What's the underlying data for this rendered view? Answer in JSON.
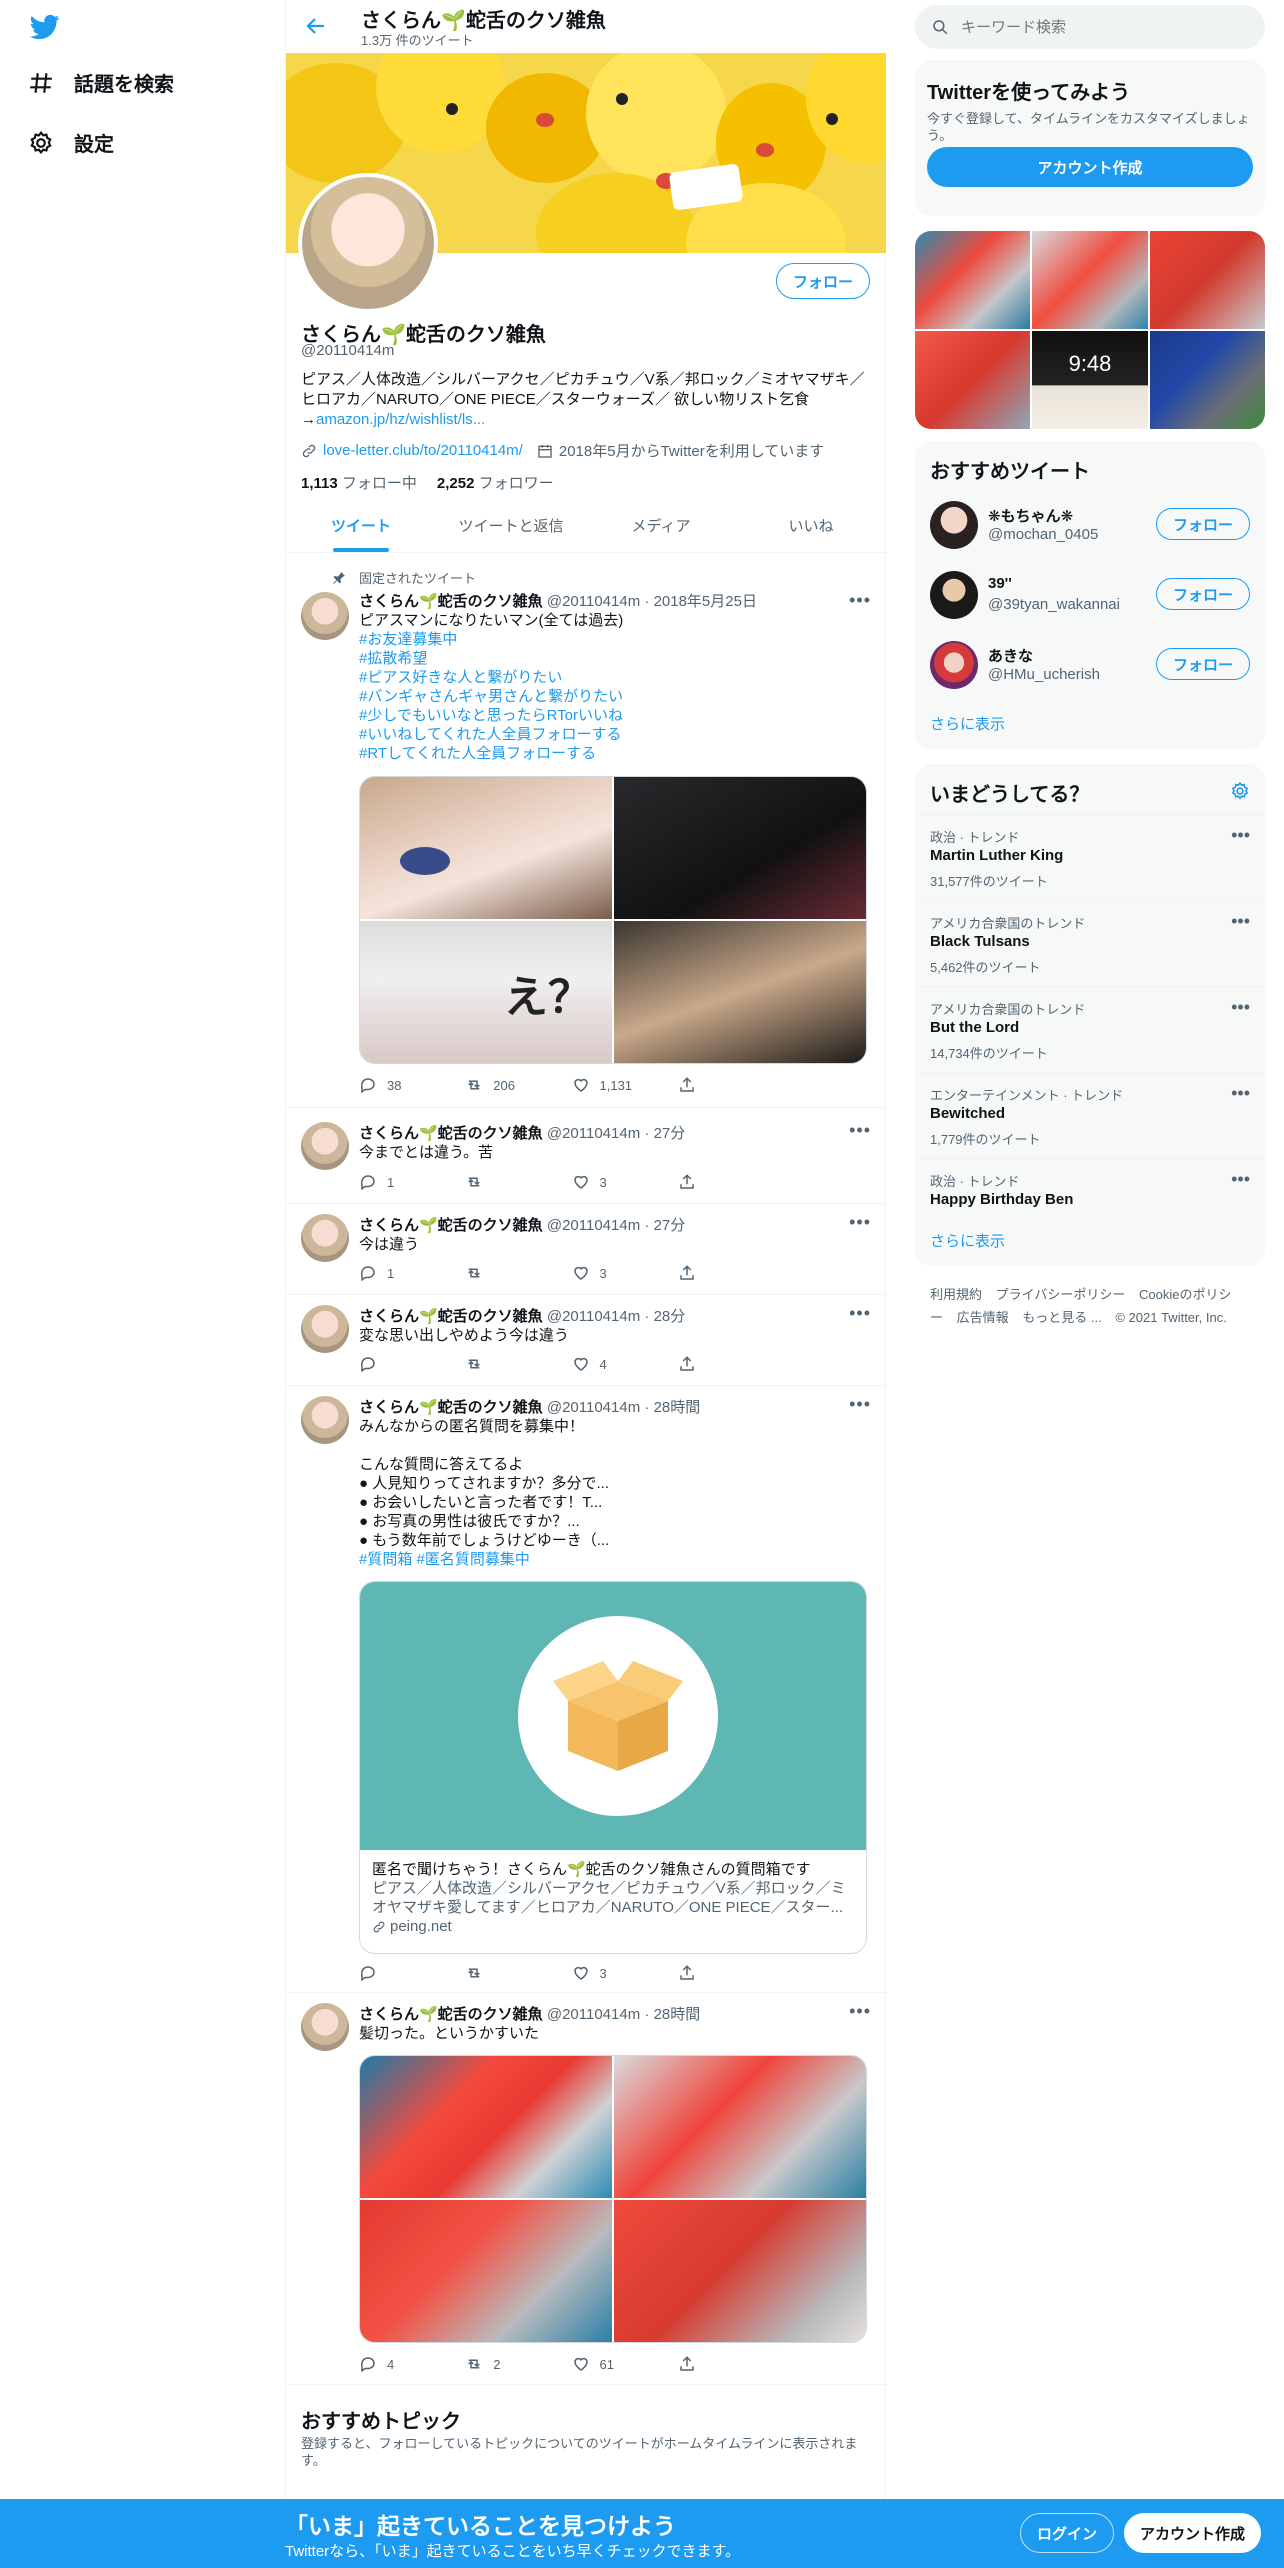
{
  "nav": {
    "logo_icon": "twitter-bird-icon",
    "explore_label": "話題を検索",
    "settings_label": "設定"
  },
  "header": {
    "name": "さくらん🌱蛇舌のクソ雑魚",
    "tweet_count": "1.3万 件のツイート"
  },
  "profile": {
    "name": "さくらん🌱蛇舌のクソ雑魚",
    "handle": "@20110414m",
    "follow_label": "フォロー",
    "bio_text": "ピアス／人体改造／シルバーアクセ／ピカチュウ／V系／邦ロック／ミオヤマザキ／ヒロアカ／NARUTO／ONE PIECE／スターウォーズ／ 欲しい物リスト乞食→",
    "bio_link": "amazon.jp/hz/wishlist/ls...",
    "website": "love-letter.club/to/20110414m/",
    "joined": "2018年5月からTwitterを利用しています",
    "following_count": "1,113",
    "following_label": "フォロー中",
    "followers_count": "2,252",
    "followers_label": "フォロワー"
  },
  "tabs": [
    "ツイート",
    "ツイートと返信",
    "メディア",
    "いいね"
  ],
  "tweets": [
    {
      "pinned_label": "固定されたツイート",
      "name": "さくらん🌱蛇舌のクソ雑魚",
      "handle": "@20110414m",
      "time": "2018年5月25日",
      "text": "ピアスマンになりたいマン(全ては過去)",
      "hashtags": [
        "#お友達募集中",
        "#拡散希望",
        "#ピアス好きな人と繋がりたい",
        "#バンギャさんギャ男さんと繋がりたい",
        "#少しでもいいなと思ったらRTorいいね",
        "#いいねしてくれた人全員フォローする",
        "#RTしてくれた人全員フォローする"
      ],
      "image_overlay": "え？",
      "replies": "38",
      "retweets": "206",
      "likes": "1,131"
    },
    {
      "name": "さくらん🌱蛇舌のクソ雑魚",
      "handle": "@20110414m",
      "time": "27分",
      "text": "今までとは違う。苦",
      "replies": "1",
      "retweets": "",
      "likes": "3"
    },
    {
      "name": "さくらん🌱蛇舌のクソ雑魚",
      "handle": "@20110414m",
      "time": "27分",
      "text": "今は違う",
      "replies": "1",
      "retweets": "",
      "likes": "3"
    },
    {
      "name": "さくらん🌱蛇舌のクソ雑魚",
      "handle": "@20110414m",
      "time": "28分",
      "text": "変な思い出しやめよう今は違う",
      "replies": "",
      "retweets": "",
      "likes": "4"
    },
    {
      "name": "さくらん🌱蛇舌のクソ雑魚",
      "handle": "@20110414m",
      "time": "28時間",
      "lines": [
        "みんなからの匿名質問を募集中！",
        "",
        "こんな質問に答えてるよ",
        "● 人見知りってされますか？多分で...",
        "● お会いしたいと言った者です！T...",
        "● お写真の男性は彼氏ですか？...",
        "● もう数年前でしょうけどゆーき（..."
      ],
      "hashtags_line": "#質問箱 #匿名質問募集中",
      "card_title": "匿名で聞けちゃう！さくらん🌱蛇舌のクソ雑魚さんの質問箱です",
      "card_desc": "ピアス／人体改造／シルバーアクセ／ピカチュウ／V系／邦ロック／ミオヤマザキ愛してます／ヒロアカ／NARUTO／ONE PIECE／スター...",
      "card_domain": "peing.net",
      "replies": "",
      "retweets": "",
      "likes": "3"
    },
    {
      "name": "さくらん🌱蛇舌のクソ雑魚",
      "handle": "@20110414m",
      "time": "28時間",
      "text": "髪切った。というかすいた",
      "replies": "4",
      "retweets": "2",
      "likes": "61"
    }
  ],
  "topics": {
    "title": "おすすめトピック",
    "desc": "登録すると、フォローしているトピックについてのツイートがホームタイムラインに表示されます。"
  },
  "right": {
    "search_placeholder": "キーワード検索",
    "try_title": "Twitterを使ってみよう",
    "try_desc": "今すぐ登録して、タイムラインをカスタマイズしましょう。",
    "signup_label": "アカウント作成",
    "media_time": "9:48",
    "rec_title": "おすすめツイート",
    "recs": [
      {
        "name": "❋もちゃん❋",
        "handle": "@mochan_0405",
        "follow": "フォロー"
      },
      {
        "name": "39''",
        "handle": "@39tyan_wakannai",
        "follow": "フォロー"
      },
      {
        "name": "あきな",
        "handle": "@HMu_ucherish",
        "follow": "フォロー"
      }
    ],
    "show_more": "さらに表示",
    "trends_title": "いまどうしてる？",
    "trends": [
      {
        "cat": "政治 · トレンド",
        "name": "Martin Luther King",
        "count": "31,577件のツイート"
      },
      {
        "cat": "アメリカ合衆国のトレンド",
        "name": "Black Tulsans",
        "count": "5,462件のツイート"
      },
      {
        "cat": "アメリカ合衆国のトレンド",
        "name": "But the Lord",
        "count": "14,734件のツイート"
      },
      {
        "cat": "エンターテインメント · トレンド",
        "name": "Bewitched",
        "count": "1,779件のツイート"
      },
      {
        "cat": "政治 · トレンド",
        "name": "Happy Birthday Ben",
        "count": ""
      }
    ],
    "footer": {
      "terms": "利用規約",
      "privacy": "プライバシーポリシー",
      "cookie": "Cookieのポリシー",
      "ads": "広告情報",
      "more": "もっと見る ...",
      "copyright": "© 2021 Twitter, Inc."
    }
  },
  "bottom": {
    "title": "「いま」起きていることを見つけよう",
    "sub": "Twitterなら、「いま」起きていることをいち早くチェックできます。",
    "login": "ログイン",
    "signup": "アカウント作成"
  }
}
